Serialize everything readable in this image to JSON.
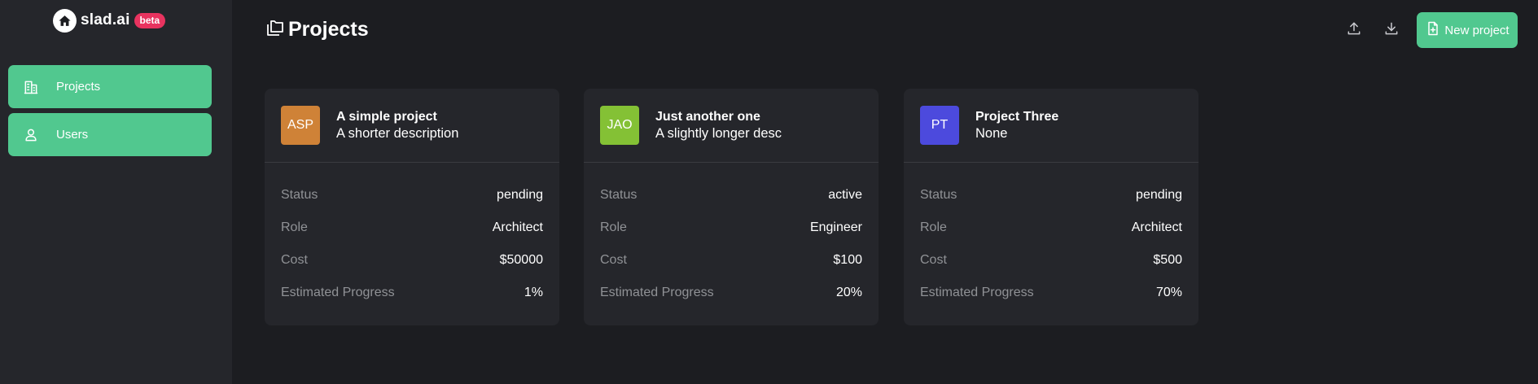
{
  "app": {
    "name": "slad.ai",
    "badge": "beta"
  },
  "sidebar": {
    "items": [
      {
        "label": "Projects",
        "icon": "building-icon"
      },
      {
        "label": "Users",
        "icon": "user-icon"
      }
    ]
  },
  "header": {
    "title": "Projects",
    "upload_icon": "upload-icon",
    "download_icon": "download-icon",
    "new_project_label": "New project"
  },
  "colors": {
    "accent": "#51c88f",
    "background": "#1c1d21",
    "panel": "#25262b",
    "badge": "#e8335f"
  },
  "projects": [
    {
      "initials": "ASP",
      "avatar_color": "#cf8237",
      "name": "A simple project",
      "description": "A shorter description",
      "fields": [
        {
          "key": "Status",
          "value": "pending"
        },
        {
          "key": "Role",
          "value": "Architect"
        },
        {
          "key": "Cost",
          "value": "$50000"
        },
        {
          "key": "Estimated Progress",
          "value": "1%"
        }
      ]
    },
    {
      "initials": "JAO",
      "avatar_color": "#84c135",
      "name": "Just another one",
      "description": "A slightly longer desc",
      "fields": [
        {
          "key": "Status",
          "value": "active"
        },
        {
          "key": "Role",
          "value": "Engineer"
        },
        {
          "key": "Cost",
          "value": "$100"
        },
        {
          "key": "Estimated Progress",
          "value": "20%"
        }
      ]
    },
    {
      "initials": "PT",
      "avatar_color": "#4c4add",
      "name": "Project Three",
      "description": "None",
      "fields": [
        {
          "key": "Status",
          "value": "pending"
        },
        {
          "key": "Role",
          "value": "Architect"
        },
        {
          "key": "Cost",
          "value": "$500"
        },
        {
          "key": "Estimated Progress",
          "value": "70%"
        }
      ]
    }
  ]
}
